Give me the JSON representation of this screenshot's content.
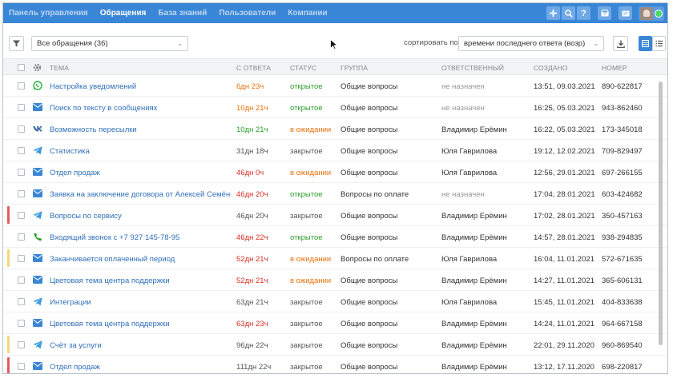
{
  "nav": {
    "items": [
      "Панель управления",
      "Обращения",
      "База знаний",
      "Пользователи",
      "Компании"
    ],
    "active_index": 1
  },
  "top_icons": [
    "plus-icon",
    "search-icon",
    "help-icon",
    "inbox-icon",
    "message-icon"
  ],
  "toolbar": {
    "cases_select": "Все обращения (36)",
    "sort_label": "сортировать по:",
    "sort_select": "времени последнего ответа (возр)"
  },
  "table": {
    "columns": [
      "ТЕМА",
      "С ОТВЕТА",
      "СТАТУС",
      "ГРУППА",
      "ОТВЕТСТВЕННЫЙ",
      "СОЗДАНО",
      "НОМЕР"
    ],
    "rows": [
      {
        "channel": "whatsapp-icon",
        "topic": "Настройка уведомлений",
        "since": "6дн 23ч",
        "since_color": "orange",
        "status": "открытое",
        "status_kind": "open",
        "group": "Общие вопросы",
        "responsible": "не назначен",
        "assigned": false,
        "created": "13:51, 09.03.2021",
        "number": "890-622817",
        "marker": ""
      },
      {
        "channel": "email-icon",
        "topic": "Поиск по тексту в сообщениях",
        "since": "10дн 21ч",
        "since_color": "orange",
        "status": "открытое",
        "status_kind": "open",
        "group": "Общие вопросы",
        "responsible": "не назначен",
        "assigned": false,
        "created": "16:25, 05.03.2021",
        "number": "943-862460",
        "marker": ""
      },
      {
        "channel": "vk-icon",
        "topic": "Возможность пересылки",
        "since": "10дн 21ч",
        "since_color": "green",
        "status": "в ожидании",
        "status_kind": "wait",
        "group": "Общие вопросы",
        "responsible": "Владимир Ерёмин",
        "assigned": true,
        "created": "16:22, 05.03.2021",
        "number": "173-345018",
        "marker": ""
      },
      {
        "channel": "telegram-icon",
        "topic": "Статистика",
        "since": "31дн 18ч",
        "since_color": "gray",
        "status": "закрытое",
        "status_kind": "closed",
        "group": "Общие вопросы",
        "responsible": "Юля Гаврилова",
        "assigned": true,
        "created": "19:12, 12.02.2021",
        "number": "709-829497",
        "marker": ""
      },
      {
        "channel": "email-icon",
        "topic": "Отдел продаж",
        "since": "46дн 0ч",
        "since_color": "red",
        "status": "в ожидании",
        "status_kind": "wait",
        "group": "Общие вопросы",
        "responsible": "Юля Гаврилова",
        "assigned": true,
        "created": "12:56, 29.01.2021",
        "number": "697-266155",
        "marker": ""
      },
      {
        "channel": "email-icon",
        "topic": "Заявка на заключение договора от Алексей Семёнова",
        "since": "46дн 20ч",
        "since_color": "red",
        "status": "открытое",
        "status_kind": "open",
        "group": "Вопросы по оплате",
        "responsible": "не назначен",
        "assigned": false,
        "created": "17:04, 28.01.2021",
        "number": "603-424682",
        "marker": ""
      },
      {
        "channel": "telegram-icon",
        "topic": "Вопросы по сервису",
        "since": "46дн 20ч",
        "since_color": "gray",
        "status": "закрытое",
        "status_kind": "closed",
        "group": "Общие вопросы",
        "responsible": "Владимир Ерёмин",
        "assigned": true,
        "created": "17:02, 28.01.2021",
        "number": "350-457163",
        "marker": "#e35d5d"
      },
      {
        "channel": "phone-icon",
        "topic": "Входящий звонок с +7 927 145-78-95",
        "since": "46дн 22ч",
        "since_color": "red",
        "status": "открытое",
        "status_kind": "open",
        "group": "Общие вопросы",
        "responsible": "Владимир Ерёмин",
        "assigned": true,
        "created": "14:57, 28.01.2021",
        "number": "938-294835",
        "marker": ""
      },
      {
        "channel": "email-icon",
        "topic": "Заканчивается оплаченный период",
        "since": "52дн 21ч",
        "since_color": "red",
        "status": "в ожидании",
        "status_kind": "wait",
        "group": "Вопросы по оплате",
        "responsible": "Юля Гаврилова",
        "assigned": true,
        "created": "16:04, 11.01.2021",
        "number": "572-671635",
        "marker": "#f5d77a"
      },
      {
        "channel": "email-icon",
        "topic": "Цветовая тема центра поддержки",
        "since": "52дн 21ч",
        "since_color": "red",
        "status": "в ожидании",
        "status_kind": "wait",
        "group": "Общие вопросы",
        "responsible": "Владимир Ерёмин",
        "assigned": true,
        "created": "14:27, 11.01.2021",
        "number": "365-606131",
        "marker": ""
      },
      {
        "channel": "telegram-icon",
        "topic": "Интеграции",
        "since": "63дн 21ч",
        "since_color": "gray",
        "status": "закрытое",
        "status_kind": "closed",
        "group": "Общие вопросы",
        "responsible": "Юля Гаврилова",
        "assigned": true,
        "created": "15:45, 11.01.2021",
        "number": "404-833638",
        "marker": ""
      },
      {
        "channel": "email-icon",
        "topic": "Цветовая тема центра поддержки",
        "since": "63дн 23ч",
        "since_color": "red",
        "status": "закрытое",
        "status_kind": "closed",
        "group": "Общие вопросы",
        "responsible": "Владимир Ерёмин",
        "assigned": true,
        "created": "14:24, 11.01.2021",
        "number": "964-667158",
        "marker": ""
      },
      {
        "channel": "telegram-icon",
        "topic": "Счёт за услуги",
        "since": "96дн 22ч",
        "since_color": "gray",
        "status": "закрытое",
        "status_kind": "closed",
        "group": "Общие вопросы",
        "responsible": "Владимир Ерёмин",
        "assigned": true,
        "created": "22:01, 29.11.2020",
        "number": "960-869540",
        "marker": "#f5d77a"
      },
      {
        "channel": "email-icon",
        "topic": "Отдел продаж",
        "since": "111дн 22ч",
        "since_color": "gray",
        "status": "закрытое",
        "status_kind": "closed",
        "group": "Общие вопросы",
        "responsible": "Владимир Ерёмин",
        "assigned": true,
        "created": "13:12, 17.11.2020",
        "number": "698-220817",
        "marker": "#e35d5d"
      }
    ]
  },
  "colors": {
    "brand": "#3a86d6",
    "link": "#2f6fb8",
    "since_orange": "#e8710a",
    "since_red": "#d93025",
    "since_green": "#2e9e2e",
    "status_open": "#2e9e2e",
    "status_wait": "#e8710a"
  }
}
